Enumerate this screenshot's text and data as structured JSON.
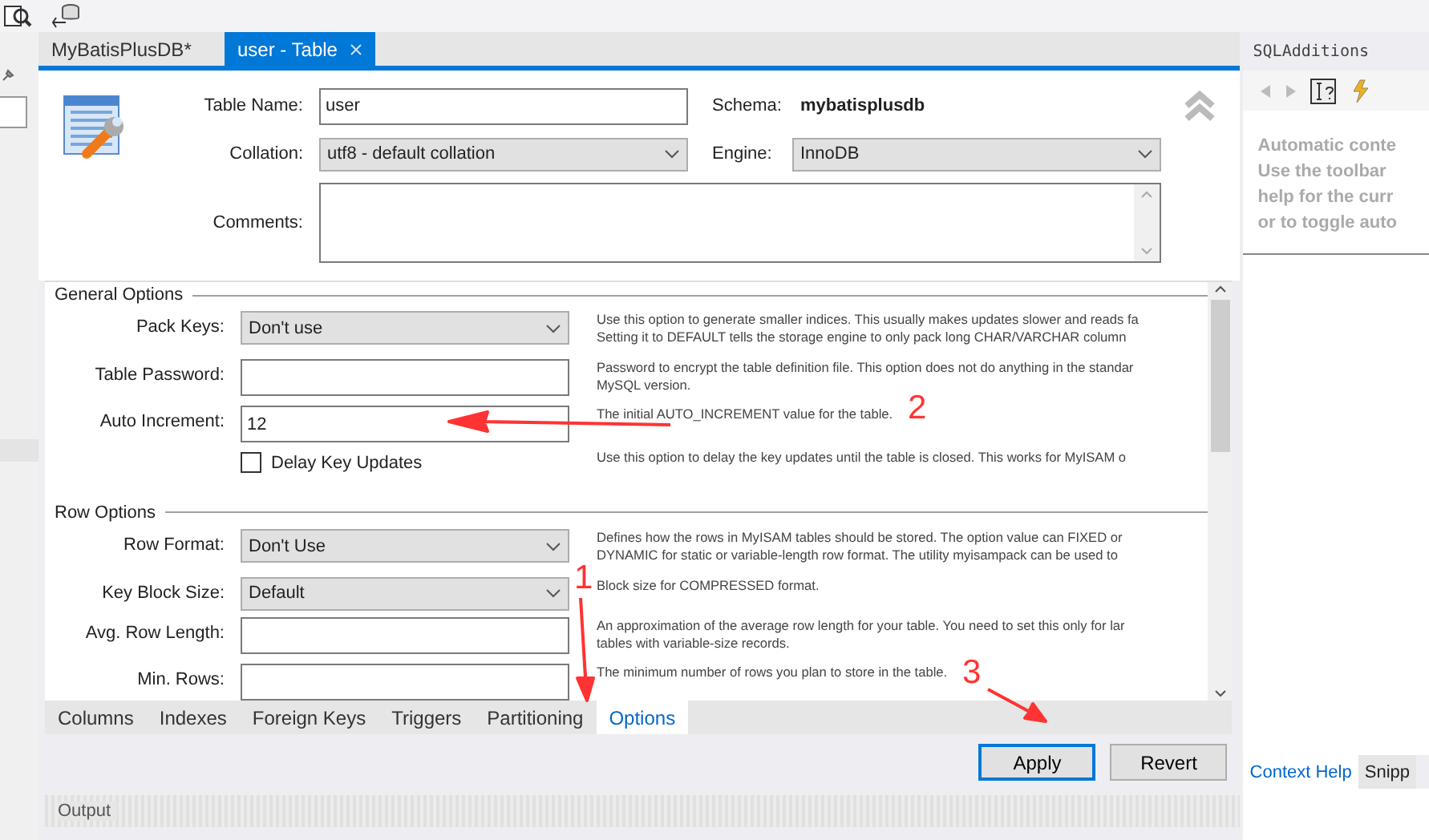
{
  "editor_tabs": [
    {
      "label": "MyBatisPlusDB*",
      "selected": false,
      "closable": false
    },
    {
      "label": "user - Table",
      "selected": true,
      "closable": true
    }
  ],
  "header": {
    "table_name_label": "Table Name:",
    "table_name": "user",
    "schema_label": "Schema:",
    "schema": "mybatisplusdb",
    "collation_label": "Collation:",
    "collation": "utf8 - default collation",
    "engine_label": "Engine:",
    "engine": "InnoDB",
    "comments_label": "Comments:"
  },
  "sections": [
    {
      "title": "General Options",
      "rows": [
        {
          "kind": "select",
          "label": "Pack Keys:",
          "value": "Don't use",
          "description": "Use this option to generate smaller indices. This usually makes updates slower and reads fa\nSetting it to DEFAULT tells the storage engine to only pack long CHAR/VARCHAR column"
        },
        {
          "kind": "input",
          "label": "Table Password:",
          "description": "Password to encrypt the table definition file. This option does not do anything in the standar\nMySQL version."
        },
        {
          "kind": "input",
          "label": "Auto Increment:",
          "value": "12",
          "description": "The initial AUTO_INCREMENT value for the table."
        },
        {
          "kind": "checkbox",
          "label": "Delay Key Updates",
          "checked": false,
          "description": "Use this option to delay the key updates until the table is closed. This works for MyISAM o"
        }
      ]
    },
    {
      "title": "Row Options",
      "rows": [
        {
          "kind": "select",
          "label": "Row Format:",
          "value": "Don't Use",
          "description": "Defines how the rows in MyISAM tables should be stored. The option value can FIXED or\nDYNAMIC for static or variable-length row format. The utility myisampack can be used to"
        },
        {
          "kind": "select",
          "label": "Key Block Size:",
          "value": "Default",
          "description": "Block size for COMPRESSED format."
        },
        {
          "kind": "input",
          "label": "Avg. Row Length:",
          "description": "An approximation of the average row length for your table. You need to set this only for lar\ntables with variable-size records."
        },
        {
          "kind": "input",
          "label": "Min. Rows:",
          "description": "The minimum number of rows you plan to store in the table."
        }
      ]
    }
  ],
  "bottom_tabs": [
    {
      "label": "Columns",
      "selected": false
    },
    {
      "label": "Indexes",
      "selected": false
    },
    {
      "label": "Foreign Keys",
      "selected": false
    },
    {
      "label": "Triggers",
      "selected": false
    },
    {
      "label": "Partitioning",
      "selected": false
    },
    {
      "label": "Options",
      "selected": true
    }
  ],
  "buttons": [
    {
      "label": "Apply",
      "selected": true
    },
    {
      "label": "Revert",
      "selected": false
    }
  ],
  "output": {
    "title": "Output"
  },
  "side_panel": {
    "title": "SQLAdditions",
    "help_text": "Automatic conte\nUse the toolbar\nhelp for the curr\nor to toggle auto",
    "tabs": [
      {
        "label": "Context Help",
        "selected": true
      },
      {
        "label": "Snipp",
        "selected": false
      }
    ]
  },
  "annotations": [
    {
      "label": "2"
    },
    {
      "label": "1"
    },
    {
      "label": "3"
    }
  ]
}
